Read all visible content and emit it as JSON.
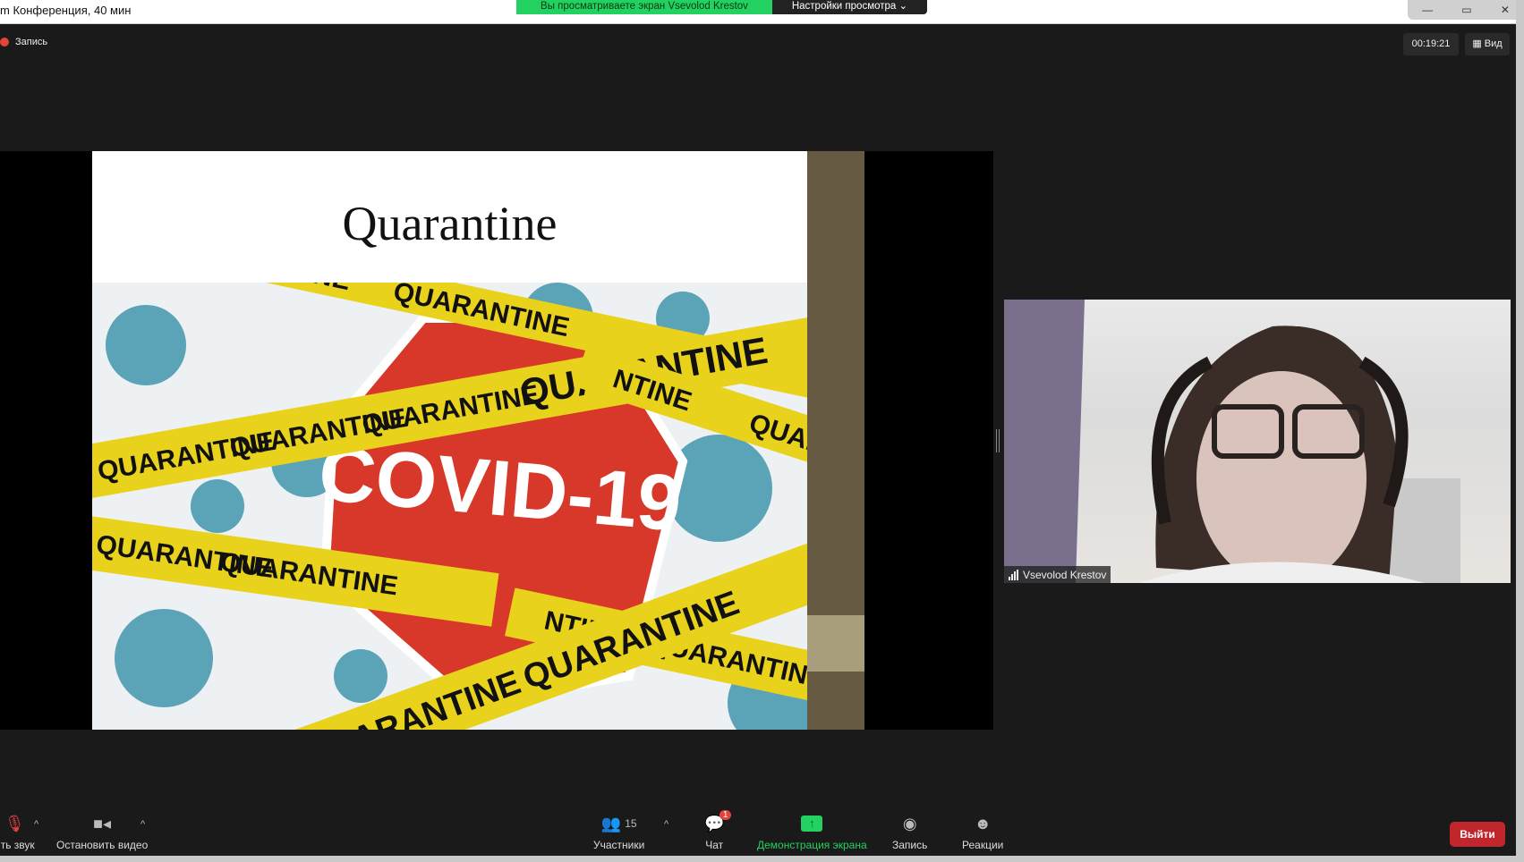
{
  "window": {
    "title": "m Конференция, 40 мин",
    "controls": [
      "—",
      "▭",
      "✕"
    ]
  },
  "banner": {
    "viewing": "Вы просматриваете экран Vsevolod Krestov",
    "view_options": "Настройки просмотра ⌄"
  },
  "top": {
    "recording": "Запись",
    "timer": "00:19:21",
    "view": "Вид"
  },
  "slide": {
    "title": "Quarantine",
    "tape_text": "QUARANTINE",
    "sign_text": "COVID-19"
  },
  "video": {
    "participant": "Vsevolod Krestov"
  },
  "toolbar": {
    "mute": "ить звук",
    "video": "Остановить видео",
    "participants": "Участники",
    "participants_count": "15",
    "chat": "Чат",
    "chat_badge": "1",
    "share": "Демонстрация экрана",
    "record": "Запись",
    "reactions": "Реакции",
    "leave": "Выйти"
  },
  "colors": {
    "share_green": "#23d160",
    "leave_red": "#c0262c",
    "tape_yellow": "#e8d21c",
    "sign_red": "#d8382a"
  }
}
